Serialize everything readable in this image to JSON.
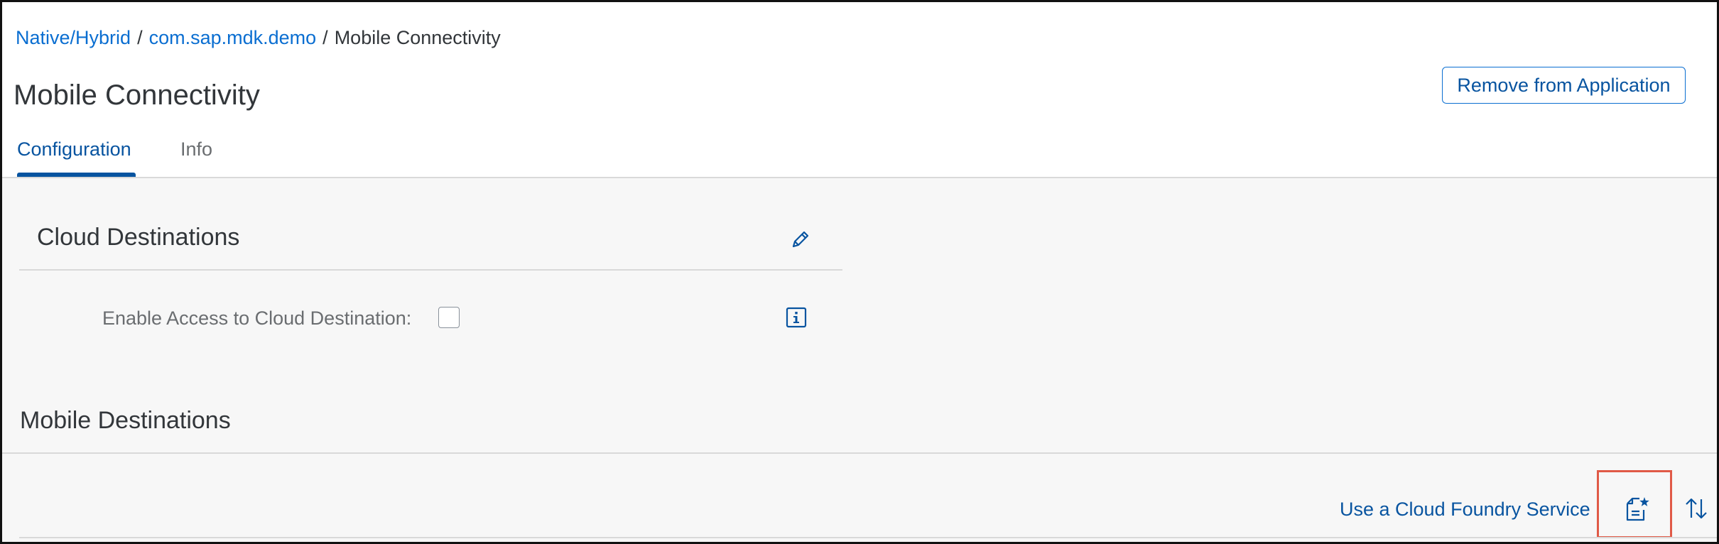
{
  "breadcrumb": {
    "items": [
      "Native/Hybrid",
      "com.sap.mdk.demo"
    ],
    "separator": "/",
    "current": "Mobile Connectivity"
  },
  "page": {
    "title": "Mobile Connectivity",
    "remove_button_label": "Remove from Application"
  },
  "tabs": [
    {
      "label": "Configuration",
      "selected": true
    },
    {
      "label": "Info",
      "selected": false
    }
  ],
  "cloud_destinations": {
    "title": "Cloud Destinations",
    "edit_icon": "pencil-icon",
    "field_label": "Enable Access to Cloud Destination:",
    "field_checked": false,
    "info_icon": "info-icon"
  },
  "mobile_destinations": {
    "title": "Mobile Destinations",
    "toolbar": {
      "link_label": "Use a Cloud Foundry Service",
      "new_icon": "new-document-icon",
      "sort_icon": "sort-icon"
    }
  },
  "colors": {
    "link": "#0a6ed1",
    "accent": "#0854a0",
    "text": "#32363a",
    "muted_text": "#6a6d70",
    "content_background": "#f7f7f7",
    "highlight": "#e05a47"
  }
}
